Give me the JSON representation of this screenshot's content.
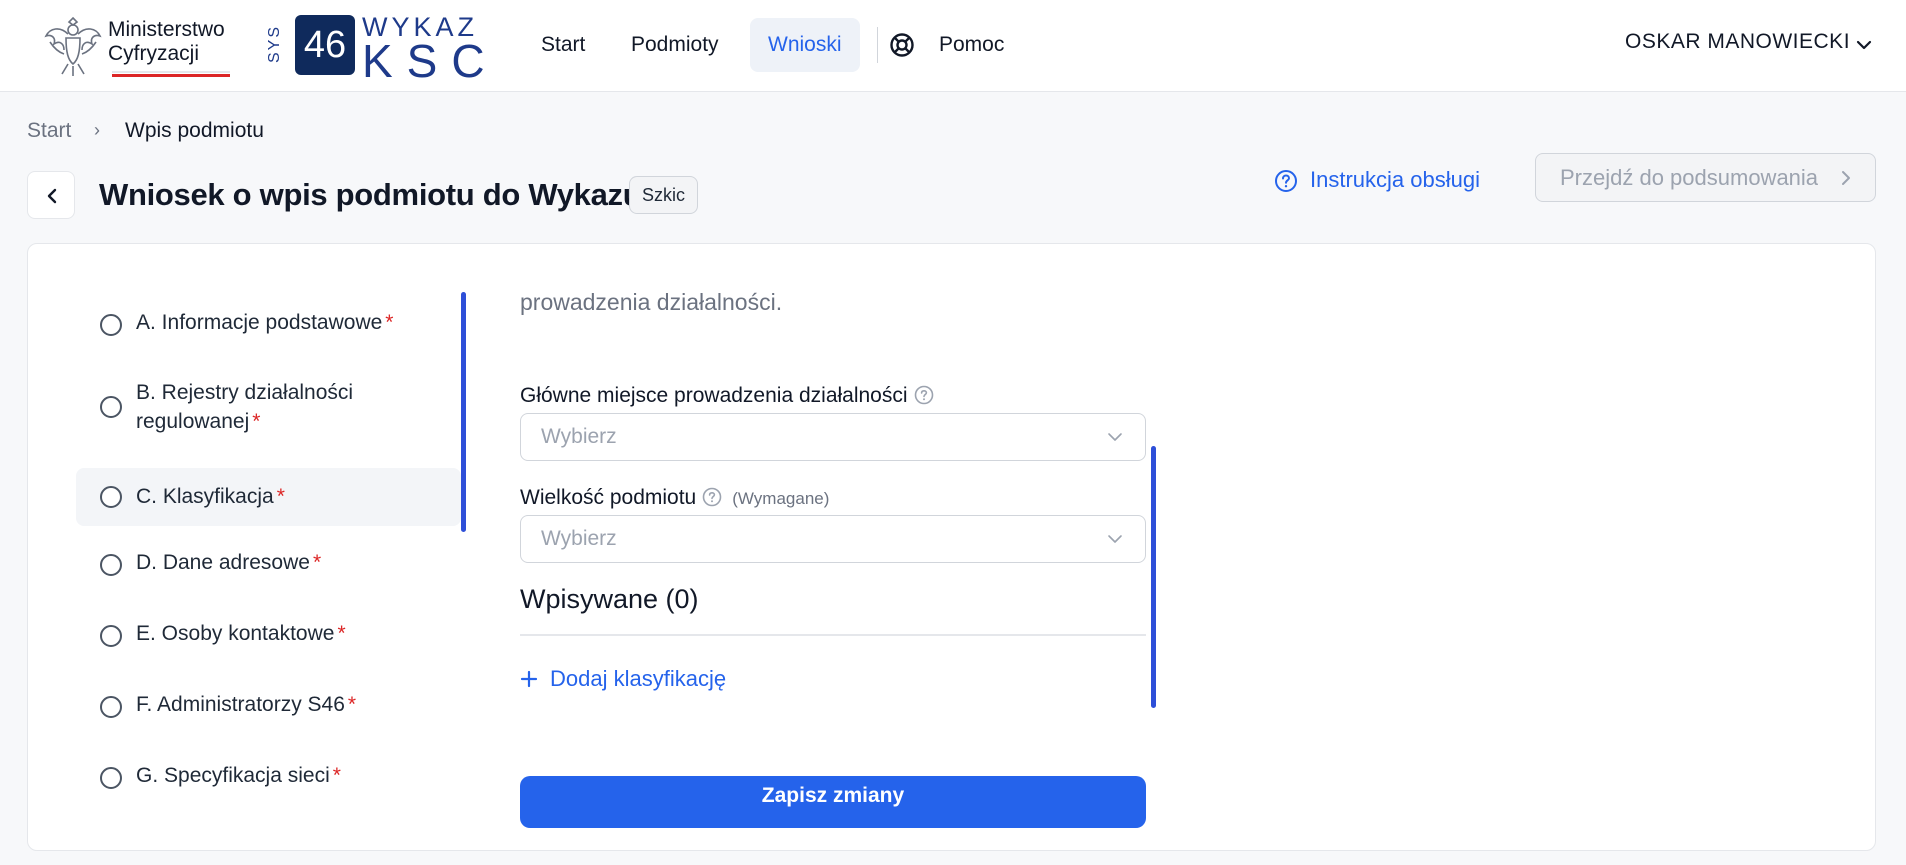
{
  "header": {
    "ministry_line1": "Ministerstwo",
    "ministry_line2": "Cyfryzacji",
    "ksc_sys": "SYS",
    "ksc_badge": "46",
    "ksc_wykaz": "WYKAZ",
    "ksc_ksc": "KSC",
    "nav": [
      {
        "label": "Start"
      },
      {
        "label": "Podmioty"
      },
      {
        "label": "Wnioski"
      },
      {
        "label": "Pomoc"
      }
    ],
    "active_nav": "Wnioski",
    "user_name": "OSKAR MANOWIECKI"
  },
  "breadcrumb": {
    "start": "Start",
    "separator": "›",
    "current": "Wpis podmiotu"
  },
  "title_row": {
    "title": "Wniosek o wpis podmiotu do Wykazu",
    "badge": "Szkic",
    "instruction_link": "Instrukcja obsługi",
    "summary_button": "Przejdź do podsumowania"
  },
  "steps": [
    {
      "label": "A. Informacje podstawowe",
      "required": "*"
    },
    {
      "label": "B. Rejestry działalności regulowanej",
      "required": "*"
    },
    {
      "label": "C. Klasyfikacja",
      "required": "*",
      "active": true
    },
    {
      "label": "D. Dane adresowe",
      "required": "*"
    },
    {
      "label": "E. Osoby kontaktowe",
      "required": "*"
    },
    {
      "label": "F. Administratorzy S46",
      "required": "*"
    },
    {
      "label": "G. Specyfikacja sieci",
      "required": "*"
    }
  ],
  "form": {
    "intro_text": "prowadzenia działalności.",
    "main_place_label": "Główne miejsce prowadzenia działalności",
    "main_place_placeholder": "Wybierz",
    "size_label": "Wielkość podmiotu",
    "size_required_note": "(Wymagane)",
    "size_placeholder": "Wybierz",
    "section_title": "Wpisywane (0)",
    "add_link": "Dodaj klasyfikację",
    "save_button": "Zapisz zmiany"
  },
  "colors": {
    "accent": "#2563eb",
    "required": "#dc2626",
    "scrollbar": "#2e4fd8"
  }
}
